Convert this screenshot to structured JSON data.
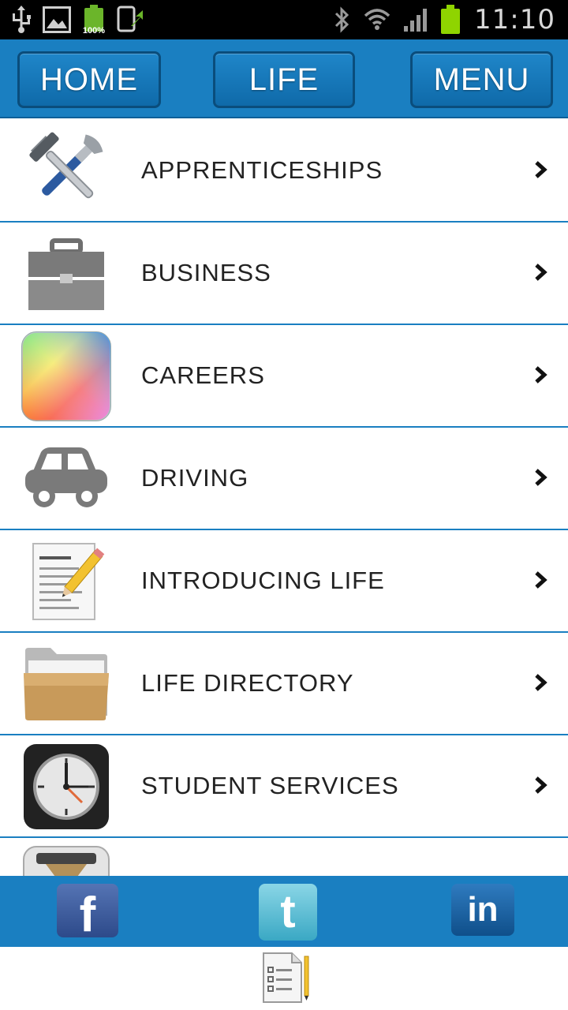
{
  "status_bar": {
    "battery_small_pct": "100%",
    "time": "11:10"
  },
  "nav": {
    "home": "HOME",
    "life": "LIFE",
    "menu": "MENU"
  },
  "list": {
    "items": [
      {
        "label": "APPRENTICESHIPS",
        "icon": "tools-icon"
      },
      {
        "label": "BUSINESS",
        "icon": "briefcase-icon"
      },
      {
        "label": "CAREERS",
        "icon": "color-wheel-icon"
      },
      {
        "label": "DRIVING",
        "icon": "car-icon"
      },
      {
        "label": "INTRODUCING LIFE",
        "icon": "document-pencil-icon"
      },
      {
        "label": "LIFE DIRECTORY",
        "icon": "folder-icon"
      },
      {
        "label": "STUDENT SERVICES",
        "icon": "clock-icon"
      },
      {
        "label": "",
        "icon": "hourglass-icon"
      }
    ]
  },
  "social": {
    "facebook": "f",
    "twitter": "t",
    "linkedin": "in"
  },
  "colors": {
    "brand_blue": "#1a7fc1",
    "status_bar": "#000000"
  }
}
